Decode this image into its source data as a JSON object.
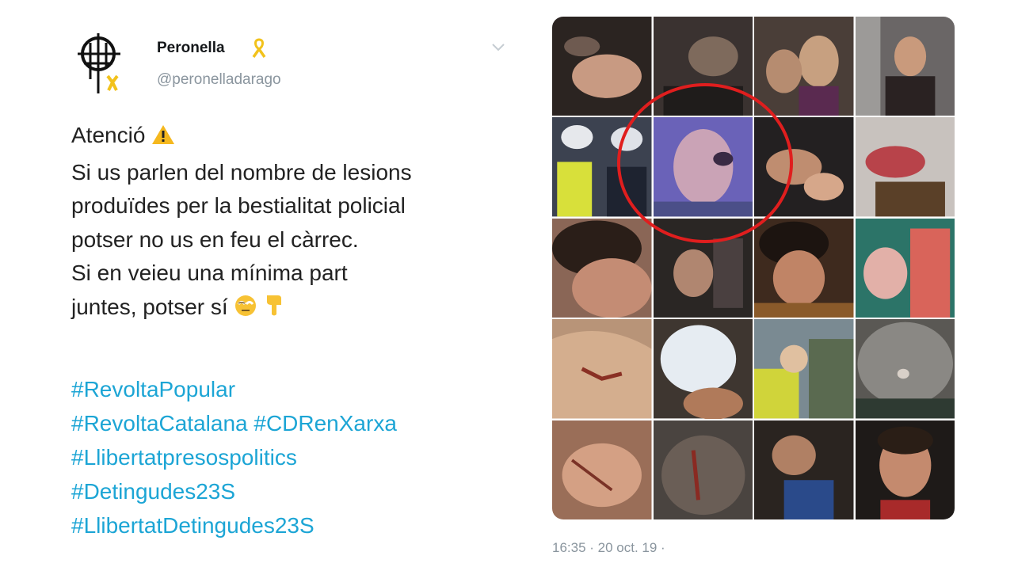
{
  "user": {
    "display_name": "Peronella",
    "handle": "@peronelladarago",
    "badge_icon": "yellow-ribbon-icon"
  },
  "tweet": {
    "lines": [
      "Atenció",
      "Si us parlen del nombre de lesions",
      "produïdes per la bestialitat policial",
      "potser no us en feu el càrrec.",
      "Si en veieu una mínima part",
      "juntes, potser sí"
    ],
    "hashtags": [
      "#RevoltaPopular",
      "#RevoltaCatalana",
      "#CDRenXarxa",
      "#Llibertatpresospolitics",
      "#Detingudes23S",
      "#LlibertatDetingudes23S"
    ],
    "timestamp": "16:35 · 20 oct. 19 ·"
  },
  "colors": {
    "hashtag": "#1ca5d5",
    "handle": "#8a959e",
    "highlight": "#e01e1e",
    "ribbon": "#f2c21b"
  },
  "gallery": {
    "rows": 5,
    "columns": 4,
    "photo_count": 20,
    "highlighted_photo": 6
  }
}
